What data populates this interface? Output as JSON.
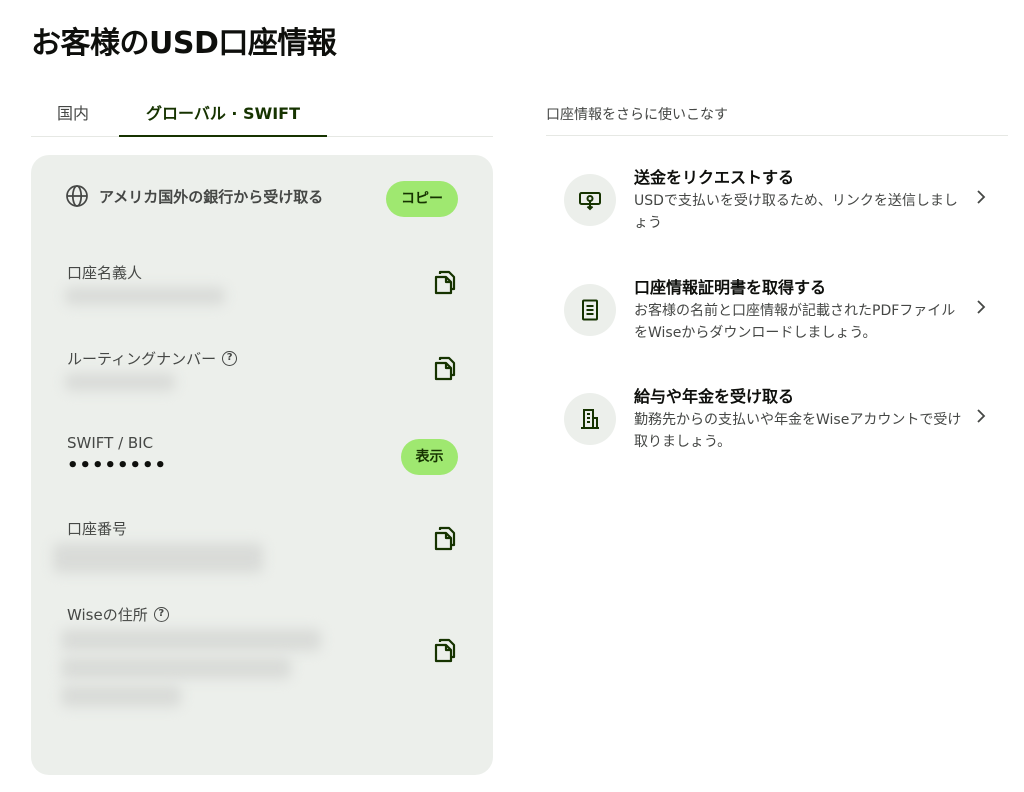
{
  "header": {
    "title": "お客様のUSD口座情報"
  },
  "tabs": [
    {
      "label": "国内"
    },
    {
      "label": "グローバル · SWIFT"
    }
  ],
  "card": {
    "header_label": "アメリカ国外の銀行から受け取る",
    "copy_label": "コピー",
    "fields": {
      "account_holder": {
        "label": "口座名義人"
      },
      "routing_number": {
        "label": "ルーティングナンバー"
      },
      "swift": {
        "label": "SWIFT / BIC",
        "value": "••••••••",
        "show_label": "表示"
      },
      "account_number": {
        "label": "口座番号"
      },
      "wise_address": {
        "label": "Wiseの住所"
      }
    },
    "help_glyph": "?"
  },
  "right": {
    "heading": "口座情報をさらに使いこなす",
    "actions": [
      {
        "title": "送金をリクエストする",
        "desc": "USDで支払いを受け取るため、リンクを送信しましょう",
        "icon": "request-money-icon"
      },
      {
        "title": "口座情報証明書を取得する",
        "desc": "お客様の名前と口座情報が記載されたPDFファイルをWiseからダウンロードしましょう。",
        "icon": "document-icon"
      },
      {
        "title": "給与や年金を受け取る",
        "desc": "勤務先からの支払いや年金をWiseアカウントで受け取りましょう。",
        "icon": "building-icon"
      }
    ]
  },
  "colors": {
    "accent": "#9fe870",
    "accent_text": "#163300",
    "card_bg": "#ecefeb"
  }
}
